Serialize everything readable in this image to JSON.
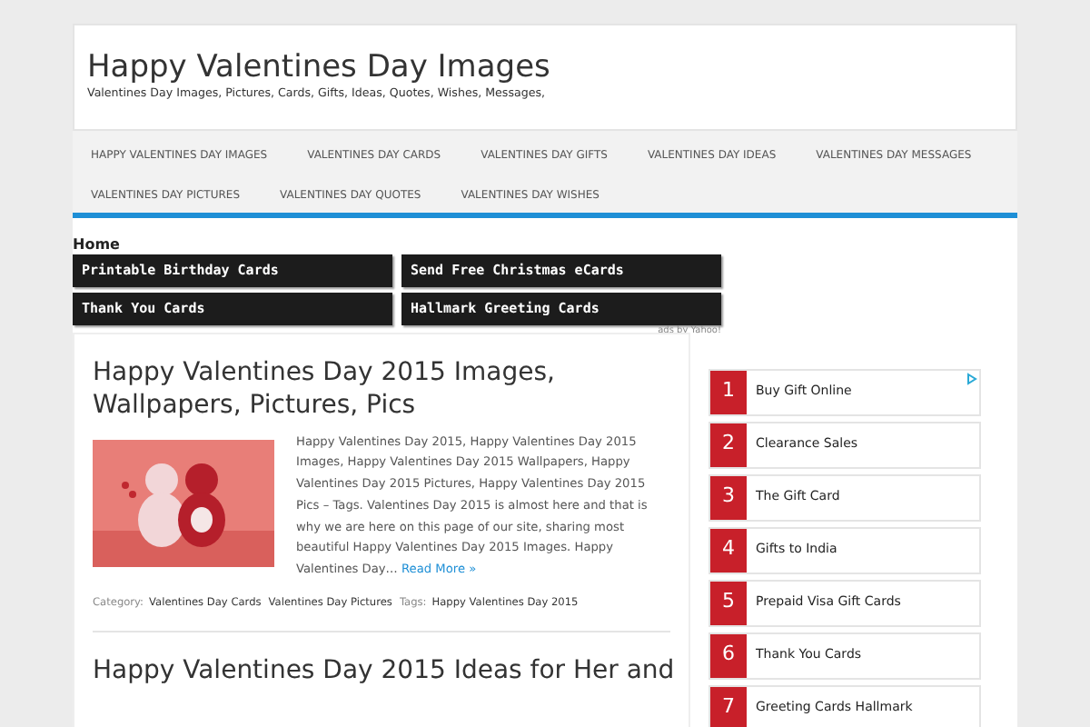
{
  "site": {
    "title": "Happy Valentines Day Images",
    "tagline": "Valentines Day Images, Pictures, Cards, Gifts, Ideas, Quotes, Wishes, Messages,"
  },
  "nav": [
    "HAPPY VALENTINES DAY IMAGES",
    "VALENTINES DAY CARDS",
    "VALENTINES DAY GIFTS",
    "VALENTINES DAY IDEAS",
    "VALENTINES DAY MESSAGES",
    "VALENTINES DAY PICTURES",
    "VALENTINES DAY QUOTES",
    "VALENTINES DAY WISHES"
  ],
  "breadcrumb": "Home",
  "ad_links": [
    "Printable Birthday Cards",
    "Send Free Christmas eCards",
    "Thank You Cards",
    "Hallmark Greeting Cards"
  ],
  "ad_credit": "ads by Yahoo!",
  "posts": [
    {
      "title": "Happy Valentines Day 2015 Images, Wallpapers, Pictures, Pics",
      "image": {
        "kind": "picture"
      },
      "excerpt": "Happy Valentines Day 2015, Happy Valentines Day 2015 Images, Happy Valentines Day 2015 Wallpapers, Happy Valentines Day 2015 Pictures, Happy Valentines Day 2015 Pics – Tags. Valentines Day 2015 is almost here and that is why we are here on this page of our site, sharing most beautiful Happy Valentines Day 2015 Images. Happy Valentines Day…",
      "read_more": "Read More »",
      "category_label": "Category:",
      "categories": [
        "Valentines Day Cards",
        "Valentines Day Pictures"
      ],
      "tags_label": "Tags:",
      "tags": [
        "Happy Valentines Day 2015"
      ]
    },
    {
      "title": "Happy Valentines Day 2015 Ideas for Her and"
    }
  ],
  "sidebar_ads": [
    {
      "number": "1",
      "label": "Buy Gift Online"
    },
    {
      "number": "2",
      "label": "Clearance Sales"
    },
    {
      "number": "3",
      "label": "The Gift Card"
    },
    {
      "number": "4",
      "label": "Gifts to India"
    },
    {
      "number": "5",
      "label": "Prepaid Visa Gift Cards"
    },
    {
      "number": "6",
      "label": "Thank You Cards"
    },
    {
      "number": "7",
      "label": "Greeting Cards Hallmark"
    }
  ]
}
